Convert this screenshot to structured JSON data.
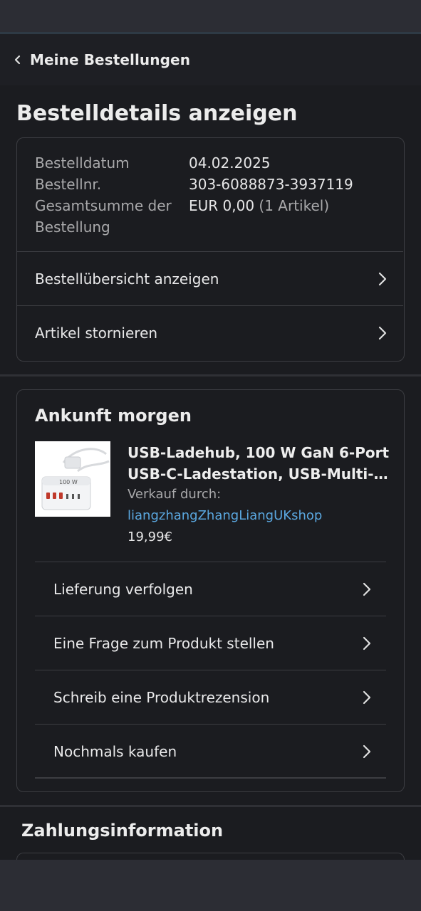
{
  "nav": {
    "back_label": "Meine Bestellungen"
  },
  "page": {
    "title": "Bestelldetails anzeigen"
  },
  "order": {
    "date_label": "Bestelldatum",
    "date_value": "04.02.2025",
    "number_label": "Bestellnr.",
    "number_value": "303-6088873-3937119",
    "total_label_line1": "Gesamtsumme der",
    "total_label_line2": "Bestellung",
    "total_value": "EUR 0,00",
    "total_items": "(1 Artikel)",
    "links": [
      {
        "label": "Bestellübersicht anzeigen"
      },
      {
        "label": "Artikel stornieren"
      }
    ]
  },
  "delivery": {
    "title": "Ankunft morgen",
    "product": {
      "title_line1": "USB-Ladehub, 100 W GaN 6-Port",
      "title_line2": "USB-C-Ladestation, USB-Multi-L...",
      "seller_label": "Verkauf durch:",
      "seller_name": "liangzhangZhangLiangUKshop",
      "price": "19,99€",
      "image_text": "100 W"
    },
    "actions": [
      {
        "label": "Lieferung verfolgen"
      },
      {
        "label": "Eine Frage zum Produkt stellen"
      },
      {
        "label": "Schreib eine Produktrezension"
      },
      {
        "label": "Nochmals kaufen"
      }
    ]
  },
  "payment": {
    "title": "Zahlungsinformation"
  },
  "colors": {
    "background": "#1b1c20",
    "link": "#5aa7df",
    "border": "#3c3d42"
  },
  "icons": {
    "back": "chevron-left-icon",
    "row_arrow": "chevron-right-icon"
  }
}
